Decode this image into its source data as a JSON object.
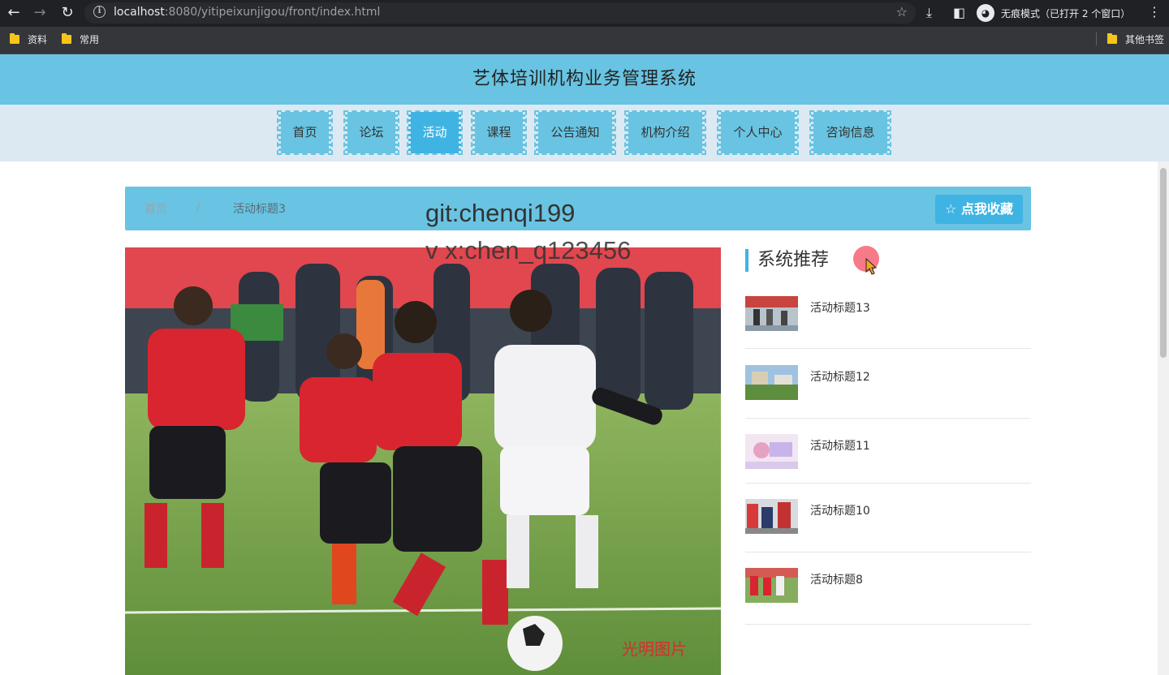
{
  "browser": {
    "url_host": "localhost",
    "url_rest": ":8080/yitipeixunjigou/front/index.html",
    "incognito_label": "无痕模式（已打开 2 个窗口）",
    "bookmarks": [
      "资料",
      "常用"
    ],
    "other_bookmarks": "其他书签"
  },
  "site": {
    "title": "艺体培训机构业务管理系统",
    "nav": [
      "首页",
      "论坛",
      "活动",
      "课程",
      "公告通知",
      "机构介绍",
      "个人中心",
      "咨询信息"
    ],
    "active_nav": "活动"
  },
  "breadcrumb": {
    "home": "首页",
    "sep": "/",
    "current": "活动标题3",
    "favorite_button": "点我收藏"
  },
  "watermark": {
    "line1": "git:chenqi199",
    "line2": "v x:chen_q123456"
  },
  "recommend": {
    "title": "系统推荐",
    "items": [
      "活动标题13",
      "活动标题12",
      "活动标题11",
      "活动标题10",
      "活动标题8"
    ]
  },
  "photo_caption": "光明图片"
}
